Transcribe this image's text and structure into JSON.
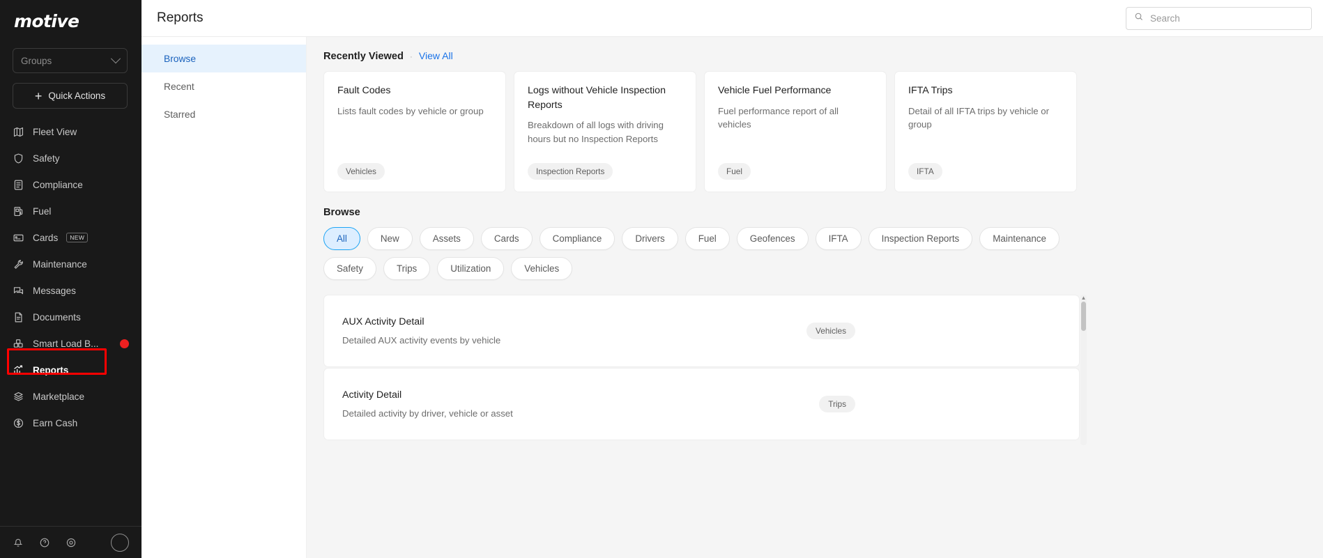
{
  "sidebar": {
    "logo": "motive",
    "groups_label": "Groups",
    "quick_actions_label": "Quick Actions",
    "items": [
      {
        "label": "Fleet View",
        "icon": "map-icon"
      },
      {
        "label": "Safety",
        "icon": "shield-icon"
      },
      {
        "label": "Compliance",
        "icon": "document-list-icon"
      },
      {
        "label": "Fuel",
        "icon": "fuel-pump-icon"
      },
      {
        "label": "Cards",
        "icon": "card-icon",
        "badge": "NEW"
      },
      {
        "label": "Maintenance",
        "icon": "wrench-icon"
      },
      {
        "label": "Messages",
        "icon": "chat-icon"
      },
      {
        "label": "Documents",
        "icon": "document-icon"
      },
      {
        "label": "Smart Load B...",
        "icon": "boxes-icon",
        "dot": true
      },
      {
        "label": "Reports",
        "icon": "bar-chart-icon",
        "active": true,
        "highlighted": true
      },
      {
        "label": "Marketplace",
        "icon": "layers-icon"
      },
      {
        "label": "Earn Cash",
        "icon": "dollar-circle-icon"
      }
    ]
  },
  "topbar": {
    "title": "Reports",
    "search_placeholder": "Search",
    "search_value": "",
    "search_icon": "search-icon"
  },
  "subnav": {
    "items": [
      {
        "label": "Browse",
        "active": true
      },
      {
        "label": "Recent",
        "active": false
      },
      {
        "label": "Starred",
        "active": false
      }
    ]
  },
  "recently_viewed": {
    "title": "Recently Viewed",
    "separator": "·",
    "view_all": "View All",
    "cards": [
      {
        "title": "Fault Codes",
        "desc": "Lists fault codes by vehicle or group",
        "tag": "Vehicles"
      },
      {
        "title": "Logs without Vehicle Inspection Reports",
        "desc": "Breakdown of all logs with driving hours but no Inspection Reports",
        "tag": "Inspection Reports"
      },
      {
        "title": "Vehicle Fuel Performance",
        "desc": "Fuel performance report of all vehicles",
        "tag": "Fuel"
      },
      {
        "title": "IFTA Trips",
        "desc": "Detail of all IFTA trips by vehicle or group",
        "tag": "IFTA"
      }
    ]
  },
  "browse": {
    "title": "Browse",
    "chips": [
      {
        "label": "All",
        "selected": true
      },
      {
        "label": "New",
        "selected": false
      },
      {
        "label": "Assets",
        "selected": false
      },
      {
        "label": "Cards",
        "selected": false
      },
      {
        "label": "Compliance",
        "selected": false
      },
      {
        "label": "Drivers",
        "selected": false
      },
      {
        "label": "Fuel",
        "selected": false
      },
      {
        "label": "Geofences",
        "selected": false
      },
      {
        "label": "IFTA",
        "selected": false
      },
      {
        "label": "Inspection Reports",
        "selected": false
      },
      {
        "label": "Maintenance",
        "selected": false
      },
      {
        "label": "Safety",
        "selected": false
      },
      {
        "label": "Trips",
        "selected": false
      },
      {
        "label": "Utilization",
        "selected": false
      },
      {
        "label": "Vehicles",
        "selected": false
      }
    ],
    "rows": [
      {
        "title": "AUX Activity Detail",
        "desc": "Detailed AUX activity events by vehicle",
        "tag": "Vehicles"
      },
      {
        "title": "Activity Detail",
        "desc": "Detailed activity by driver, vehicle or asset",
        "tag": "Trips"
      }
    ]
  },
  "colors": {
    "sidebar_bg": "#191919",
    "accent_blue": "#1a73e8",
    "chip_selected_bg": "#ddeeff",
    "chip_selected_border": "#1ea5f5",
    "highlight_red": "#ff0000",
    "alert_dot": "#ee2020"
  }
}
